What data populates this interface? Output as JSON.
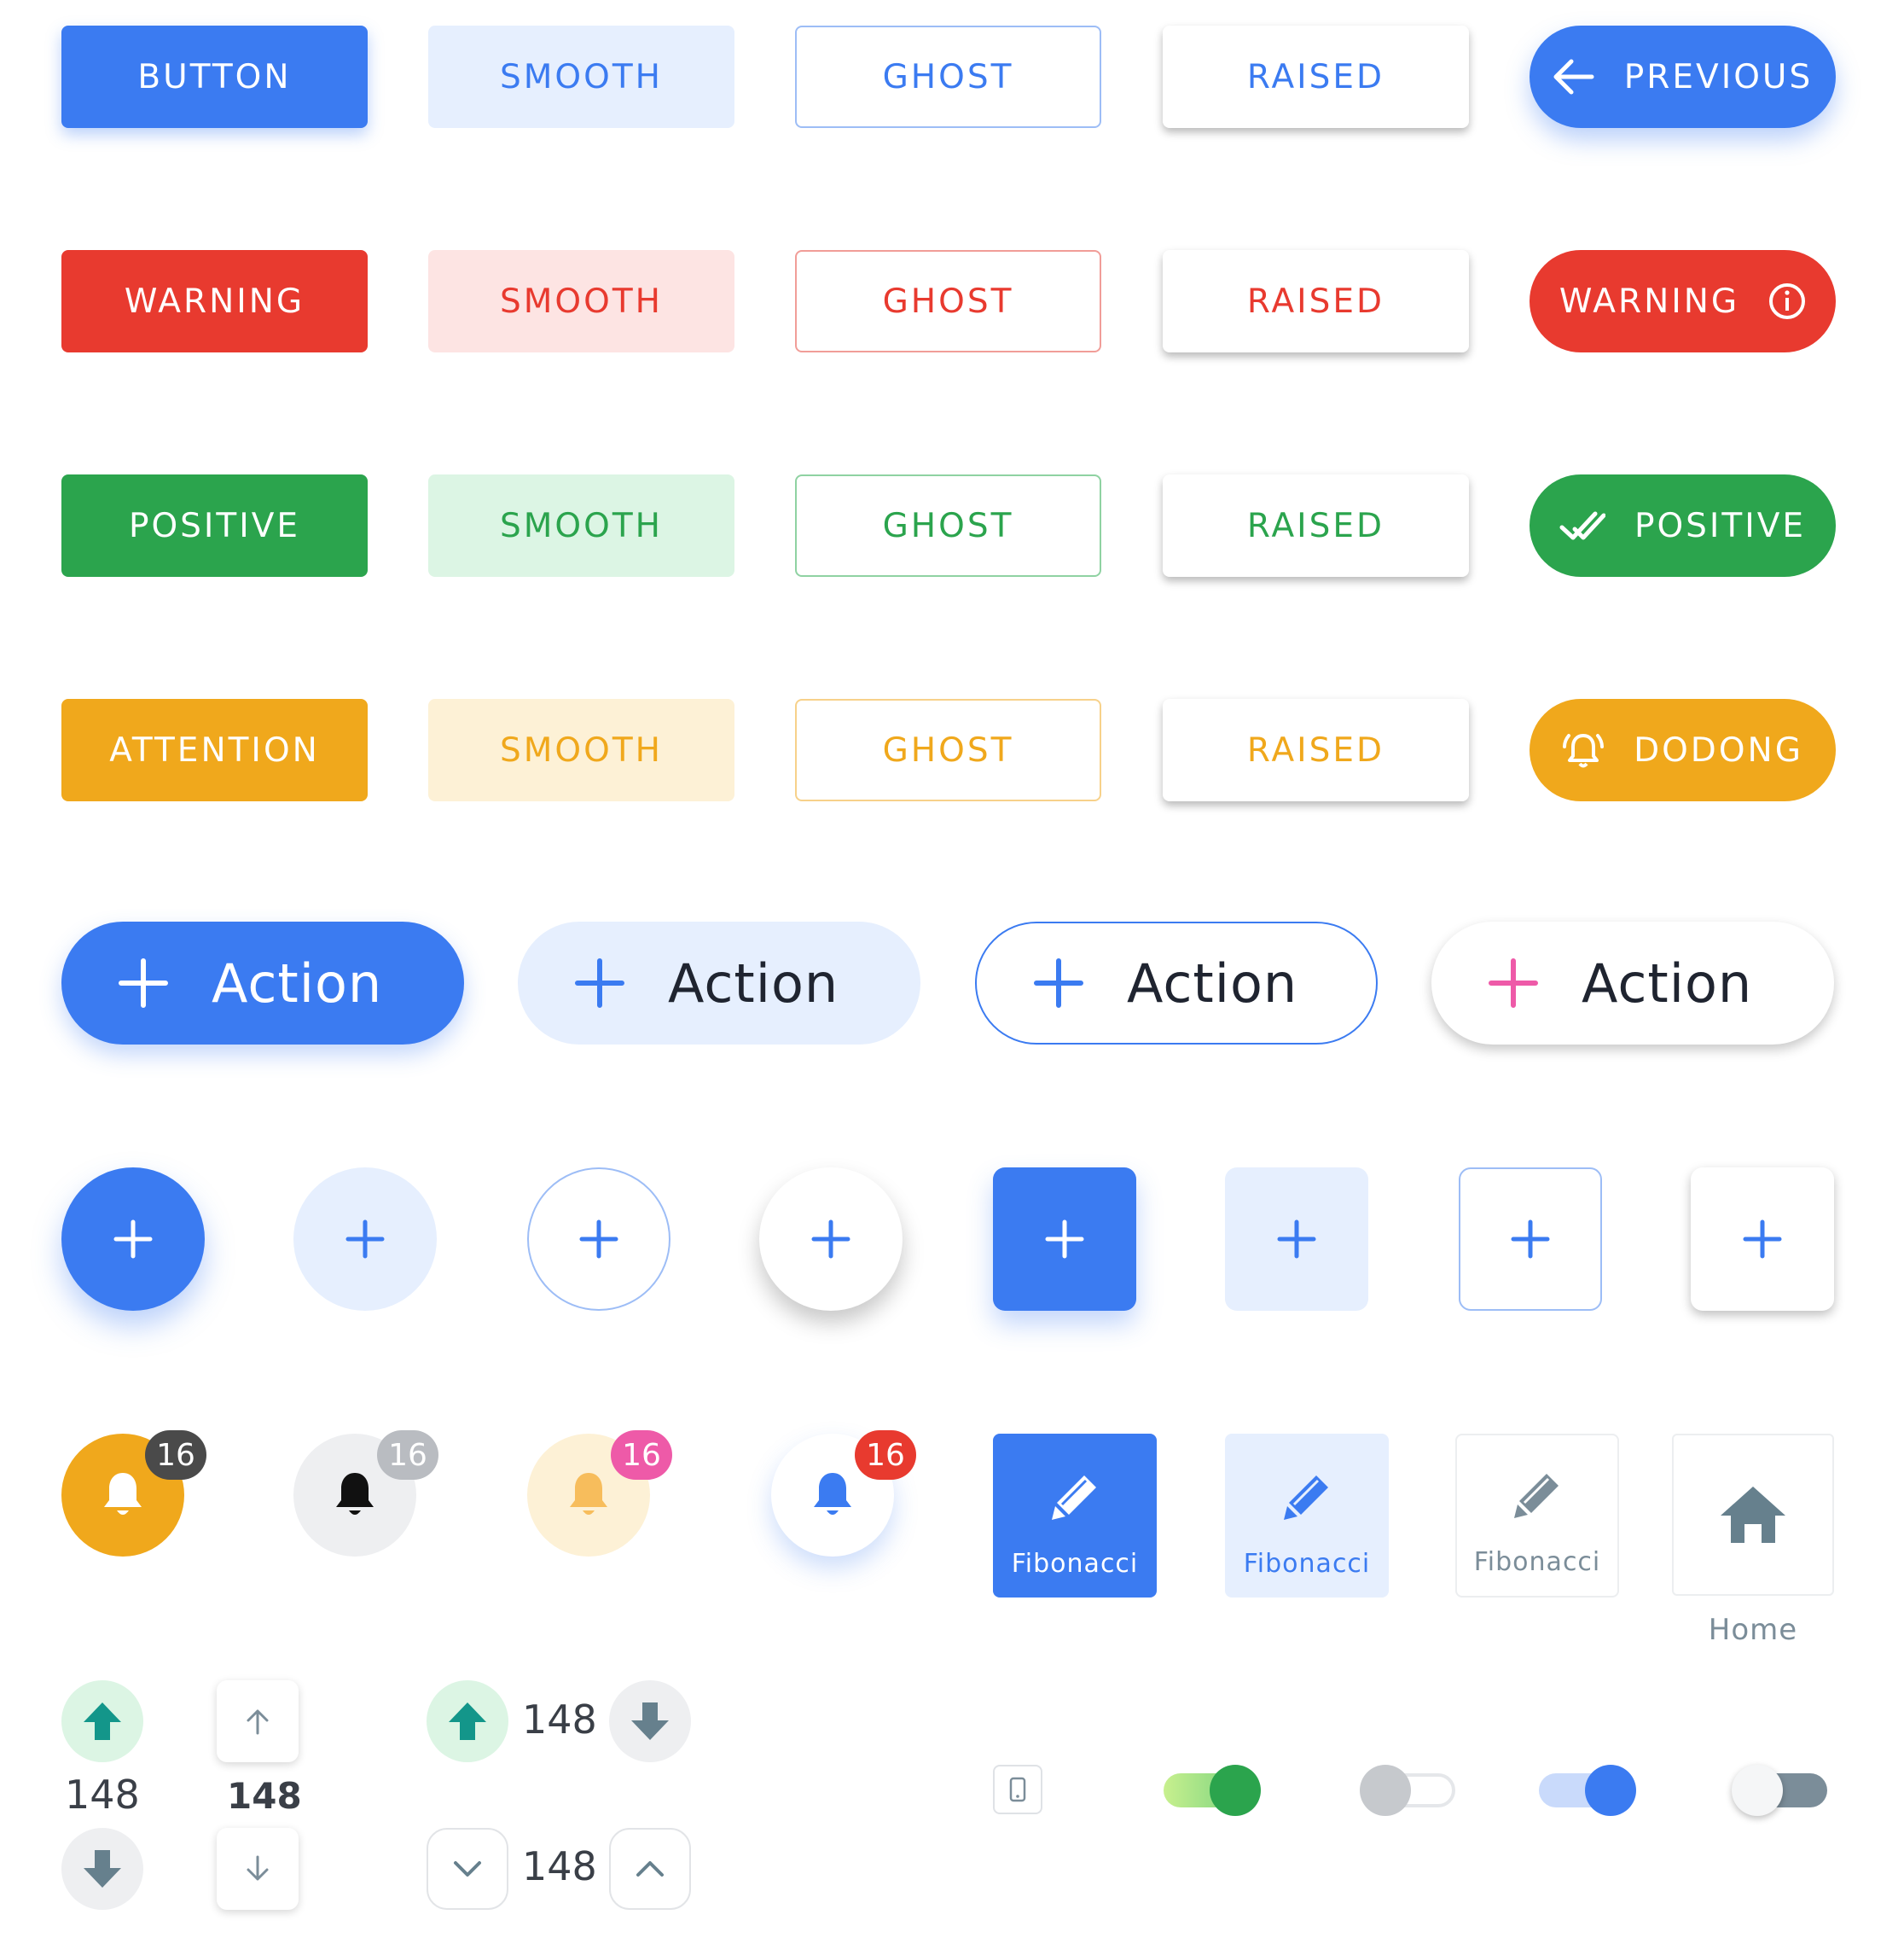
{
  "colors": {
    "primary": "#3b7bf1",
    "warning": "#e83a2f",
    "positive": "#2ba44d",
    "attention": "#f0a81c",
    "pink": "#ee5aa8",
    "gray": "#7b8d99",
    "teal": "#13968a"
  },
  "rows": [
    {
      "solid": "BUTTON",
      "smooth": "SMOOTH",
      "ghost": "GHOST",
      "raised": "RAISED",
      "pill": "PREVIOUS",
      "pill_icon": "arrow-left-icon"
    },
    {
      "solid": "WARNING",
      "smooth": "SMOOTH",
      "ghost": "GHOST",
      "raised": "RAISED",
      "pill": "WARNING",
      "pill_icon": "info-icon"
    },
    {
      "solid": "POSITIVE",
      "smooth": "SMOOTH",
      "ghost": "GHOST",
      "raised": "RAISED",
      "pill": "POSITIVE",
      "pill_icon": "double-check-icon"
    },
    {
      "solid": "ATTENTION",
      "smooth": "SMOOTH",
      "ghost": "GHOST",
      "raised": "RAISED",
      "pill": "DODONG",
      "pill_icon": "alarm-bell-icon"
    }
  ],
  "actions": [
    "Action",
    "Action",
    "Action",
    "Action"
  ],
  "notifications": {
    "count": "16"
  },
  "tiles": [
    {
      "label": "Fibonacci",
      "icon": "pencil-icon"
    },
    {
      "label": "Fibonacci",
      "icon": "pencil-icon"
    },
    {
      "label": "Fibonacci",
      "icon": "pencil-icon"
    }
  ],
  "home": {
    "label": "Home",
    "icon": "home-icon"
  },
  "steppers": {
    "vertical_round": "148",
    "vertical_square": "148",
    "horizontal_round": "148",
    "horizontal_square": "148"
  },
  "toggles": [
    {
      "on": true,
      "style": "green"
    },
    {
      "on": false,
      "style": "gray-outline"
    },
    {
      "on": true,
      "style": "blue"
    },
    {
      "on": false,
      "style": "slate"
    }
  ]
}
